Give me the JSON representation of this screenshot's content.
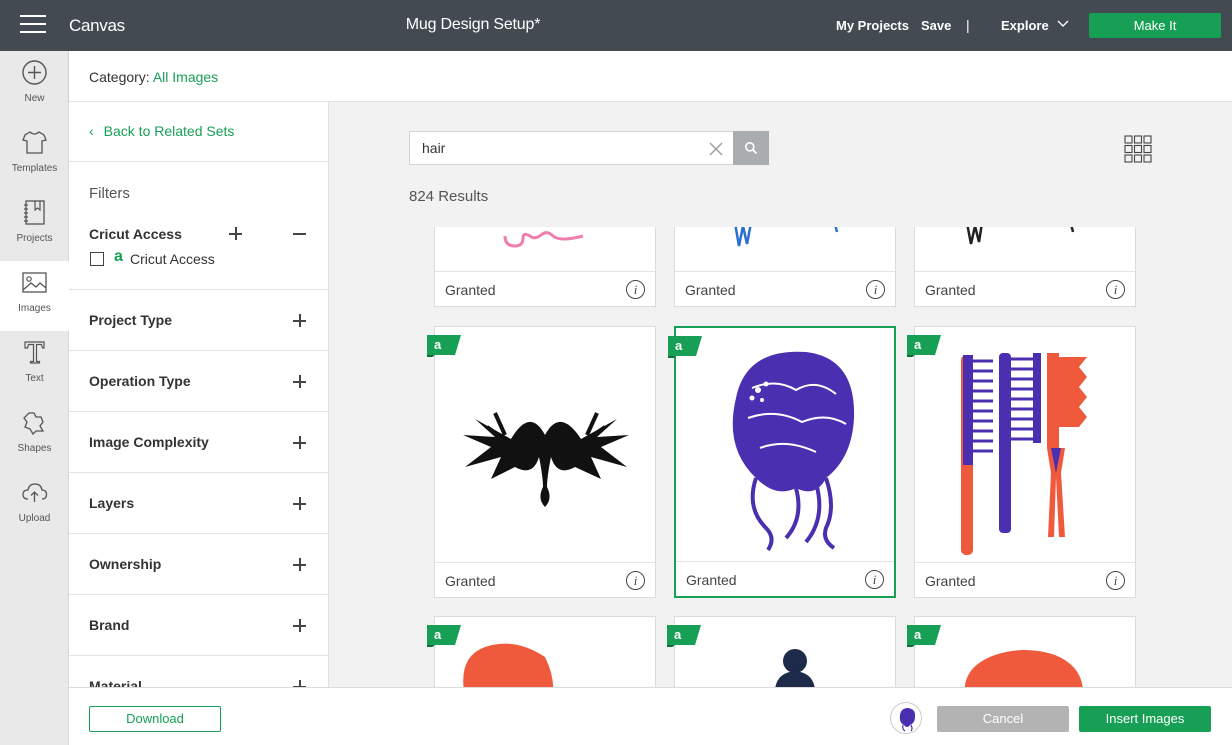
{
  "topbar": {
    "app_name": "Canvas",
    "doc_title": "Mug Design Setup*",
    "my_projects": "My Projects",
    "save": "Save",
    "separator": "|",
    "explore": "Explore",
    "make_it": "Make It"
  },
  "rail": [
    {
      "label": "New",
      "icon": "plus-circle-icon"
    },
    {
      "label": "Templates",
      "icon": "shirt-icon"
    },
    {
      "label": "Projects",
      "icon": "notebook-icon"
    },
    {
      "label": "Images",
      "icon": "image-icon",
      "active": true
    },
    {
      "label": "Text",
      "icon": "text-icon"
    },
    {
      "label": "Shapes",
      "icon": "shapes-icon"
    },
    {
      "label": "Upload",
      "icon": "upload-cloud-icon"
    }
  ],
  "category": {
    "label": "Category:",
    "value": "All Images"
  },
  "filters": {
    "back_link": "Back to Related Sets",
    "title": "Filters",
    "cricut_access": {
      "title": "Cricut Access",
      "option_glyph": "a",
      "option_label": "Cricut Access"
    },
    "sections": [
      "Project Type",
      "Operation Type",
      "Image Complexity",
      "Layers",
      "Ownership",
      "Brand",
      "Material"
    ]
  },
  "search": {
    "value": "hair",
    "results": "824 Results"
  },
  "tiles": {
    "status": "Granted",
    "info": "i"
  },
  "bottom": {
    "download": "Download",
    "cancel": "Cancel",
    "insert": "Insert Images"
  },
  "colors": {
    "accent_green": "#17a055",
    "topbar": "#434a51",
    "purple": "#4a2fb0",
    "coral": "#ef5a3c",
    "navy": "#1d2a4a"
  }
}
